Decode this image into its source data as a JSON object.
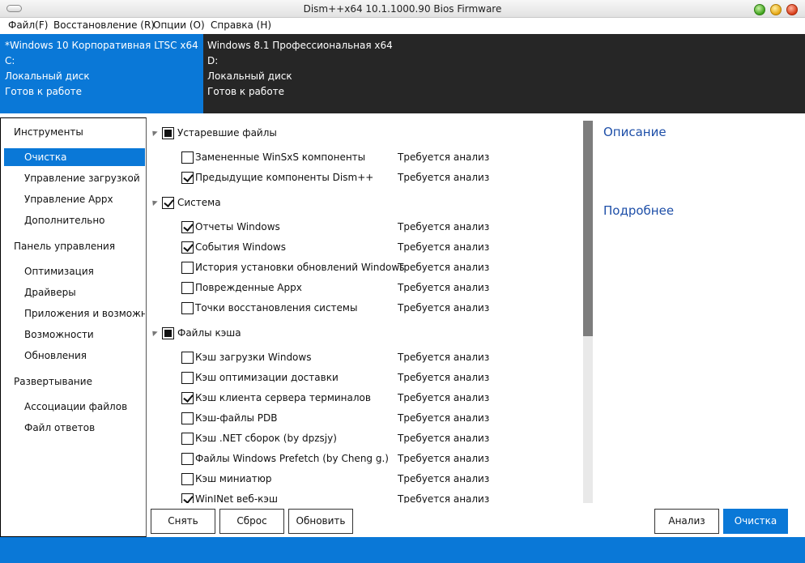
{
  "window": {
    "title": "Dism++x64 10.1.1000.90 Bios Firmware"
  },
  "menu": [
    "Файл(F)",
    "Восстановление (R)",
    "Опции (O)",
    "Справка (H)"
  ],
  "os_panels": [
    {
      "name": "*Windows 10 Корпоративная LTSC x64",
      "drive": "C:",
      "type": "Локальный диск",
      "status": "Готов к работе"
    },
    {
      "name": "Windows 8.1 Профессиональная x64",
      "drive": "D:",
      "type": "Локальный диск",
      "status": "Готов к работе"
    }
  ],
  "nav": {
    "sections": [
      {
        "title": "Инструменты",
        "items": [
          "Очистка",
          "Управление загрузкой",
          "Управление Appx",
          "Дополнительно"
        ]
      },
      {
        "title": "Панель управления",
        "items": [
          "Оптимизация",
          "Драйверы",
          "Приложения и возможнос",
          "Возможности",
          "Обновления"
        ]
      },
      {
        "title": "Развертывание",
        "items": [
          "Ассоциации файлов",
          "Файл ответов"
        ]
      }
    ],
    "active": "Очистка"
  },
  "cleanup": {
    "groups": [
      {
        "label": "Устаревшие файлы",
        "state": "partial",
        "items": [
          {
            "label": "Замененные WinSxS компоненты",
            "checked": false,
            "status": "Требуется анализ"
          },
          {
            "label": "Предыдущие компоненты Dism++",
            "checked": true,
            "status": "Требуется анализ"
          }
        ]
      },
      {
        "label": "Система",
        "state": "checked",
        "items": [
          {
            "label": "Отчеты Windows",
            "checked": true,
            "status": "Требуется анализ"
          },
          {
            "label": "События Windows",
            "checked": true,
            "status": "Требуется анализ"
          },
          {
            "label": "История установки обновлений Windows",
            "checked": false,
            "status": "Требуется анализ"
          },
          {
            "label": "Поврежденные Appx",
            "checked": false,
            "status": "Требуется анализ"
          },
          {
            "label": "Точки восстановления системы",
            "checked": false,
            "status": "Требуется анализ"
          }
        ]
      },
      {
        "label": "Файлы кэша",
        "state": "partial",
        "items": [
          {
            "label": "Кэш загрузки Windows",
            "checked": false,
            "status": "Требуется анализ"
          },
          {
            "label": "Кэш оптимизации доставки",
            "checked": false,
            "status": "Требуется анализ"
          },
          {
            "label": "Кэш клиента сервера терминалов",
            "checked": true,
            "status": "Требуется анализ"
          },
          {
            "label": "Кэш-файлы PDB",
            "checked": false,
            "status": "Требуется анализ"
          },
          {
            "label": "Кэш .NET сборок (by dpzsjy)",
            "checked": false,
            "status": "Требуется анализ"
          },
          {
            "label": "Файлы Windows Prefetch (by Cheng g.)",
            "checked": false,
            "status": "Требуется анализ"
          },
          {
            "label": "Кэш миниатюр",
            "checked": false,
            "status": "Требуется анализ"
          },
          {
            "label": "WinINet веб-кэш",
            "checked": true,
            "status": "Требуется анализ"
          }
        ]
      }
    ]
  },
  "description": {
    "title": "Описание",
    "more": "Подробнее"
  },
  "buttons": {
    "clear": "Снять",
    "reset": "Сброс",
    "refresh": "Обновить",
    "analyze": "Анализ",
    "clean": "Очистка"
  },
  "colors": {
    "accent": "#0a78d7",
    "dark_panel": "#262626",
    "link": "#1e4fa8"
  }
}
